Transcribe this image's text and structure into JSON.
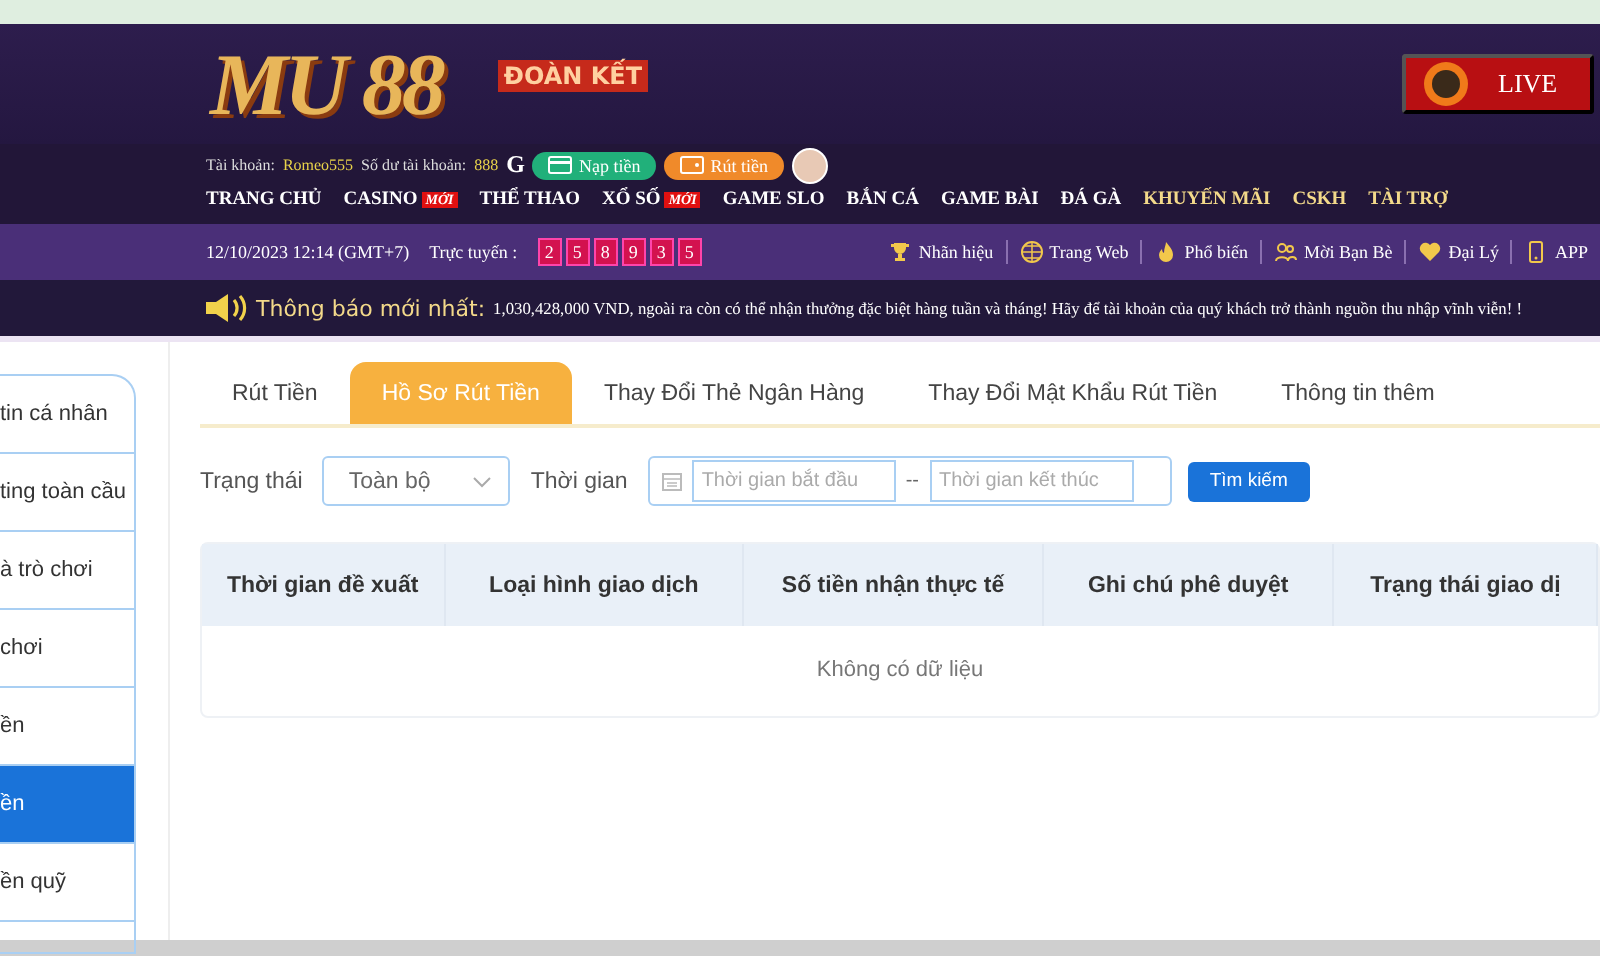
{
  "header": {
    "logo": "MU 88",
    "slogan": "ĐOÀN KẾT",
    "live_button": "LIVE"
  },
  "account": {
    "account_label": "Tài khoản:",
    "username": "Romeo555",
    "balance_label": "Số dư tài khoản:",
    "balance": "888",
    "refresh": "G",
    "deposit_button": "Nạp tiền",
    "withdraw_button": "Rút tiền"
  },
  "nav": [
    {
      "label": "TRANG CHỦ",
      "color": "#ffffff"
    },
    {
      "label": "CASINO",
      "badge": "MỚI",
      "color": "#ffffff"
    },
    {
      "label": "THỂ THAO",
      "color": "#ffffff"
    },
    {
      "label": "XỔ SỐ",
      "badge": "MỚI",
      "color": "#ffffff"
    },
    {
      "label": "GAME SLO",
      "color": "#ffffff"
    },
    {
      "label": "BẮN CÁ",
      "color": "#ffffff"
    },
    {
      "label": "GAME BÀI",
      "color": "#ffffff"
    },
    {
      "label": "ĐÁ GÀ",
      "color": "#ffffff"
    },
    {
      "label": "KHUYẾN MÃI",
      "color": "#f3d98a"
    },
    {
      "label": "CSKH",
      "color": "#f3d98a"
    },
    {
      "label": "TÀI TRỢ",
      "color": "#f3d98a"
    }
  ],
  "info_bar": {
    "datetime": "12/10/2023 12:14 (GMT+7)",
    "online_label": "Trực tuyến :",
    "online_digits": [
      "2",
      "5",
      "8",
      "9",
      "3",
      "5"
    ],
    "links": [
      {
        "label": "Nhãn hiệu"
      },
      {
        "label": "Trang Web"
      },
      {
        "label": "Phổ biến"
      },
      {
        "label": "Mời Bạn Bè"
      },
      {
        "label": "Đại Lý"
      },
      {
        "label": "APP"
      }
    ]
  },
  "ticker": {
    "title": "Thông báo mới nhất:",
    "message": "1,030,428,000 VND, ngoài ra còn có thể nhận thưởng đặc biệt hàng tuần và tháng! Hãy để tài khoản của quý khách trở thành nguồn thu nhập vĩnh viễn! !"
  },
  "sidebar": {
    "items": [
      {
        "label": "tin cá nhân",
        "selected": false
      },
      {
        "label": "ting toàn cầu",
        "selected": false
      },
      {
        "label": "à trò chơi",
        "selected": false
      },
      {
        "label": "chơi",
        "selected": false
      },
      {
        "label": "ền",
        "selected": false
      },
      {
        "label": "ền",
        "selected": true
      },
      {
        "label": "ền quỹ",
        "selected": false
      }
    ]
  },
  "tabs": [
    {
      "label": "Rút Tiền",
      "selected": false
    },
    {
      "label": "Hồ Sơ Rút Tiền",
      "selected": true
    },
    {
      "label": "Thay Đổi Thẻ Ngân Hàng",
      "selected": false
    },
    {
      "label": "Thay Đổi Mật Khẩu Rút Tiền",
      "selected": false
    },
    {
      "label": "Thông tin thêm",
      "selected": false
    }
  ],
  "filters": {
    "status_label": "Trạng thái",
    "status_value": "Toàn bộ",
    "time_label": "Thời gian",
    "start_placeholder": "Thời gian bắt đầu",
    "separator": "--",
    "end_placeholder": "Thời gian kết thúc",
    "search_button": "Tìm kiếm"
  },
  "table": {
    "columns": [
      "Thời gian đề xuất",
      "Loại hình giao dịch",
      "Số tiền nhận thực tế",
      "Ghi chú phê duyệt",
      "Trạng thái giao dị"
    ],
    "empty_text": "Không có dữ liệu"
  }
}
